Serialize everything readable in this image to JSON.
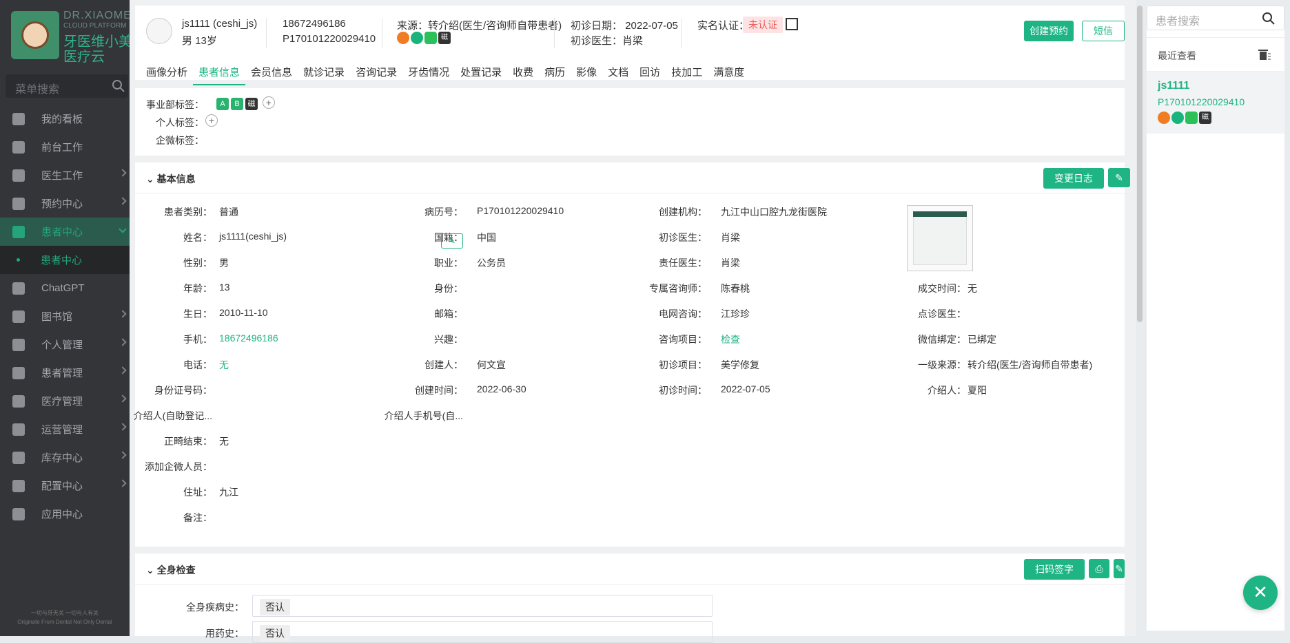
{
  "brand": {
    "en": "DR.XIAOMEI",
    "en2": "CLOUD PLATFORM",
    "cn1": "牙医维小美",
    "cn2": "医疗云"
  },
  "menu_search": {
    "placeholder": "菜单搜索"
  },
  "nav": [
    {
      "label": "我的看板",
      "icon": "dashboard-icon"
    },
    {
      "label": "前台工作",
      "icon": "monitor-icon"
    },
    {
      "label": "医生工作",
      "icon": "medical-cross-icon"
    },
    {
      "label": "预约中心",
      "icon": "clock-icon"
    },
    {
      "label": "患者中心",
      "icon": "patient-icon"
    },
    {
      "label": "患者中心",
      "icon": "dot-icon"
    },
    {
      "label": "ChatGPT",
      "icon": "bulb-icon"
    },
    {
      "label": "图书馆",
      "icon": "video-icon"
    },
    {
      "label": "个人管理",
      "icon": "person-icon"
    },
    {
      "label": "患者管理",
      "icon": "user-add-icon"
    },
    {
      "label": "医疗管理",
      "icon": "clipboard-icon"
    },
    {
      "label": "运营管理",
      "icon": "bar-chart-icon"
    },
    {
      "label": "库存中心",
      "icon": "grid-icon"
    },
    {
      "label": "配置中心",
      "icon": "gear-icon"
    },
    {
      "label": "应用中心",
      "icon": "apps-icon"
    }
  ],
  "slogan": {
    "cn": "一切与牙无关 一切与人有关",
    "en": "Originate From Dental Not Only Dental"
  },
  "header": {
    "name": "js1111 (ceshi_js)",
    "gender_age": "男 13岁",
    "phone": "18672496186",
    "record_no": "P170101220029410",
    "source": "来源：转介绍(医生/咨询师自带患者)",
    "first_date": "初诊日期：  2022-07-05",
    "first_doctor": "初诊医生：肖梁",
    "realname_label": "实名认证：",
    "realname_status": "未认证",
    "btn_appointment": "创建预约",
    "btn_sms": "短信"
  },
  "tabs": [
    "画像分析",
    "患者信息",
    "会员信息",
    "就诊记录",
    "咨询记录",
    "牙齿情况",
    "处置记录",
    "收费",
    "病历",
    "影像",
    "文档",
    "回访",
    "技加工",
    "满意度"
  ],
  "tags": {
    "dept_label": "事业部标签：",
    "dept_tags": [
      "A",
      "B",
      "磁"
    ],
    "personal_label": "个人标签：",
    "wecom_label": "企微标签："
  },
  "basic": {
    "title": "基本信息",
    "btn_changelog": "变更日志",
    "col1": [
      {
        "label": "患者类别：",
        "value": "普通"
      },
      {
        "label": "姓名：",
        "value": "js1111(ceshi_js)"
      },
      {
        "label": "性别：",
        "value": "男"
      },
      {
        "label": "年龄：",
        "value": "13"
      },
      {
        "label": "生日：",
        "value": "2010-11-10"
      },
      {
        "label": "手机：",
        "value": "18672496186"
      },
      {
        "label": "电话：",
        "value": "无"
      },
      {
        "label": "身份证号码：",
        "value": ""
      },
      {
        "label": "介绍人(自助登记...",
        "value": ""
      },
      {
        "label": "正畸结束：",
        "value": "无"
      },
      {
        "label": "添加企微人员：",
        "value": ""
      },
      {
        "label": "住址：",
        "value": "九江"
      },
      {
        "label": "备注：",
        "value": ""
      }
    ],
    "col2": [
      {
        "label": "病历号：",
        "value": "P170101220029410"
      },
      {
        "label": "国籍：",
        "value": "中国"
      },
      {
        "label": "职业：",
        "value": "公务员"
      },
      {
        "label": "身份：",
        "value": ""
      },
      {
        "label": "邮箱：",
        "value": ""
      },
      {
        "label": "兴趣：",
        "value": ""
      },
      {
        "label": "创建人：",
        "value": "何文宣"
      },
      {
        "label": "创建时间：",
        "value": "2022-06-30"
      },
      {
        "label": "介绍人手机号(自...",
        "value": ""
      }
    ],
    "col3": [
      {
        "label": "创建机构：",
        "value": "九江中山口腔九龙街医院"
      },
      {
        "label": "初诊医生：",
        "value": "肖梁"
      },
      {
        "label": "责任医生：",
        "value": "肖梁"
      },
      {
        "label": "专属咨询师：",
        "value": "陈春桃"
      },
      {
        "label": "电网咨询：",
        "value": "江珍珍"
      },
      {
        "label": "咨询项目：",
        "value": "检查"
      },
      {
        "label": "初诊项目：",
        "value": "美学修复"
      },
      {
        "label": "初诊时间：",
        "value": "2022-07-05"
      }
    ],
    "col4": [
      {
        "label": "成交时间：",
        "value": "无"
      },
      {
        "label": "点诊医生：",
        "value": ""
      },
      {
        "label": "微信绑定：",
        "value": "已绑定"
      },
      {
        "label": "一级来源：",
        "value": "转介绍(医生/咨询师自带患者)"
      },
      {
        "label": "介绍人：",
        "value": "夏阳"
      }
    ]
  },
  "exam": {
    "title": "全身检查",
    "btn_scan": "扫码签字",
    "f1_label": "全身疾病史：",
    "f1_value": "否认",
    "f2_label": "用药史：",
    "f2_value": "否认"
  },
  "right": {
    "search_placeholder": "患者搜索",
    "recent_title": "最近查看",
    "recent_name": "js1111",
    "recent_no": "P170101220029410"
  },
  "colors": {
    "accent": "#1eb484",
    "sidebar": "#333538",
    "danger": "#f05a5a"
  }
}
